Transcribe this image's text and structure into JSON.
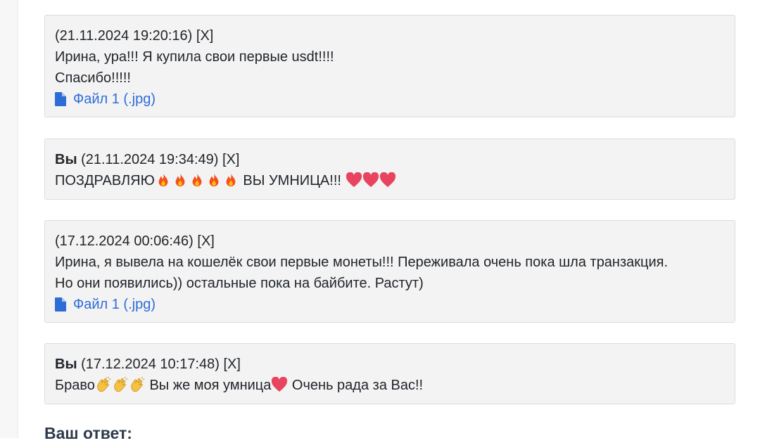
{
  "messages": [
    {
      "author": "",
      "timestamp": "(21.11.2024 19:20:16)",
      "delete": "[X]",
      "lines": [
        "Ирина, ура!!! Я купила свои первые usdt!!!!",
        "Спасибо!!!!!"
      ],
      "attachment": "Файл 1 (.jpg)"
    },
    {
      "author": "Вы",
      "timestamp": "(21.11.2024 19:34:49)",
      "delete": "[X]",
      "text_before": "ПОЗДРАВЛЯЮ",
      "text_after": " ВЫ УМНИЦА!!! ",
      "emoji_before": [
        "fire",
        "fire",
        "fire",
        "fire",
        "fire"
      ],
      "emoji_after": [
        "heart",
        "heart",
        "heart"
      ]
    },
    {
      "author": "",
      "timestamp": "(17.12.2024 00:06:46)",
      "delete": "[X]",
      "lines": [
        "Ирина, я вывела на кошелёк свои первые монеты!!! Переживала очень пока шла транзакция.",
        "Но они появились)) остальные пока на байбите. Растут)"
      ],
      "attachment": "Файл 1 (.jpg)"
    },
    {
      "author": "Вы",
      "timestamp": "(17.12.2024 10:17:48)",
      "delete": "[X]",
      "text_a": "Браво",
      "text_b": " Вы же моя умница",
      "text_c": " Очень рада за Вас!!",
      "emoji_a": [
        "clap",
        "clap",
        "clap"
      ],
      "emoji_b": [
        "heart"
      ]
    }
  ],
  "reply_heading": "Ваш ответ:",
  "colors": {
    "link": "#2f6dd6",
    "card_bg": "#f3f3f4",
    "fire": "#f4511e",
    "heart": "#e8435f",
    "clap": "#f6c244"
  }
}
